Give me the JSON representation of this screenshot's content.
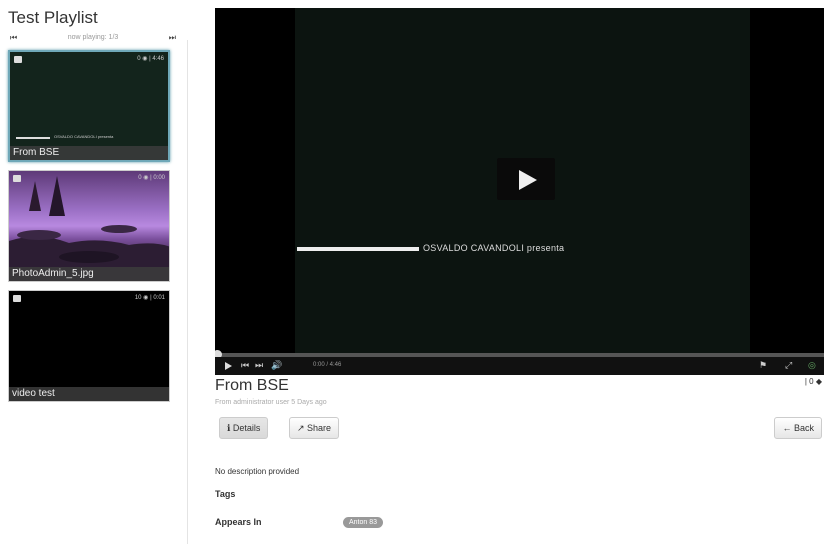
{
  "playlist": {
    "title": "Test Playlist",
    "prev_glyph": "⏮",
    "next_glyph": "⏭",
    "status": "now playing: 1/3",
    "items": [
      {
        "caption": "From BSE",
        "meta": "0 ◉ | 4:46",
        "type_icon": "film-icon"
      },
      {
        "caption": "PhotoAdmin_5.jpg",
        "meta": "0 ◉ | 0:00",
        "type_icon": "image-icon"
      },
      {
        "caption": "video test",
        "meta": "10 ◉ | 0:01",
        "type_icon": "film-icon"
      }
    ]
  },
  "player": {
    "credit_text": "OSVALDO CAVANDOLI presenta",
    "thumb_credit": "OSVALDO CAVANDOLI presenta",
    "time": "0:00 / 4:46",
    "progress": 0,
    "controls": {
      "prev": "⏮",
      "next": "⏭",
      "volume": "🔊",
      "flag": "⚑",
      "fullscreen": "⤢",
      "settings": "◎"
    }
  },
  "video": {
    "title": "From BSE",
    "count": "| 0 ◆",
    "meta": "From administrator user 5 Days ago"
  },
  "buttons": {
    "details": "ℹ Details",
    "share": "↗ Share",
    "back": "← Back"
  },
  "info": {
    "description": "No description provided",
    "tags_label": "Tags",
    "appears_label": "Appears In",
    "appears_tag": "Anton 83"
  },
  "colors": {
    "active_border": "#6fa8b8",
    "pill": "#999999"
  }
}
